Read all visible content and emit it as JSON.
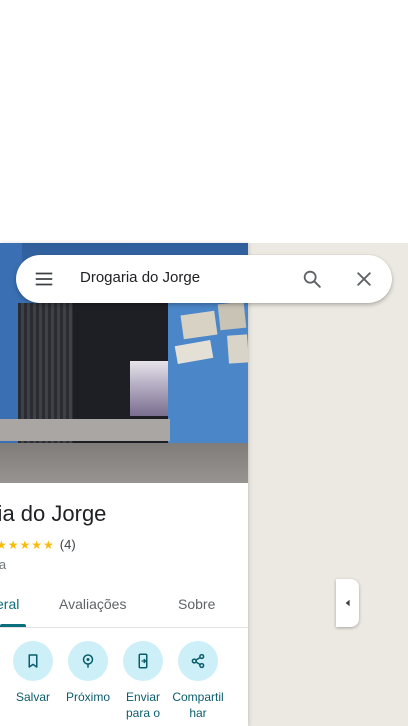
{
  "search": {
    "query": "Drogaria do Jorge",
    "menu_icon": "menu-icon",
    "search_icon": "search-icon",
    "close_icon": "close-icon"
  },
  "place": {
    "name": "aria do Jorge",
    "stars": "★★★★★",
    "review_count": "(4)",
    "category": "ia"
  },
  "tabs": [
    {
      "label": "eral",
      "active": true
    },
    {
      "label": "Avaliações",
      "active": false
    },
    {
      "label": "Sobre",
      "active": false
    }
  ],
  "actions": [
    {
      "label": "Salvar",
      "icon": "bookmark-icon"
    },
    {
      "label": "Próximo",
      "icon": "nearby-icon"
    },
    {
      "label": "Enviar para o",
      "icon": "send-to-phone-icon"
    },
    {
      "label": "Compartilhar",
      "icon": "share-icon"
    }
  ],
  "side_panel_toggle": {
    "icon": "collapse-arrow-icon"
  },
  "colors": {
    "accent": "#0b6e7d",
    "action_circle": "#cdeff7",
    "star": "#f9bb0c",
    "map_background": "#ece9e2"
  }
}
